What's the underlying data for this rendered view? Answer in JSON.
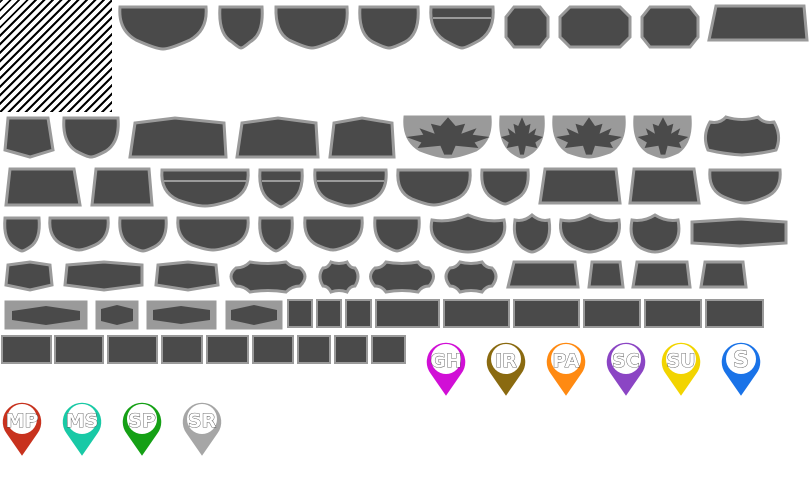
{
  "colors": {
    "shield_fill": "#4a4a4a",
    "shield_border": "#9a9a9a",
    "leaf": "#4a4a4a"
  },
  "pins": [
    {
      "label": "GH",
      "color": "#d10fd6"
    },
    {
      "label": "IR",
      "color": "#8a6a10"
    },
    {
      "label": "PA",
      "color": "#ff8a12"
    },
    {
      "label": "SC",
      "color": "#8b45c4"
    },
    {
      "label": "SU",
      "color": "#f2d400"
    },
    {
      "label": "S",
      "color": "#1a73e8"
    },
    {
      "label": "MP",
      "color": "#c8321e"
    },
    {
      "label": "MS",
      "color": "#19c9a6"
    },
    {
      "label": "SP",
      "color": "#15a015"
    },
    {
      "label": "SR",
      "color": "#a6a6a6"
    }
  ]
}
